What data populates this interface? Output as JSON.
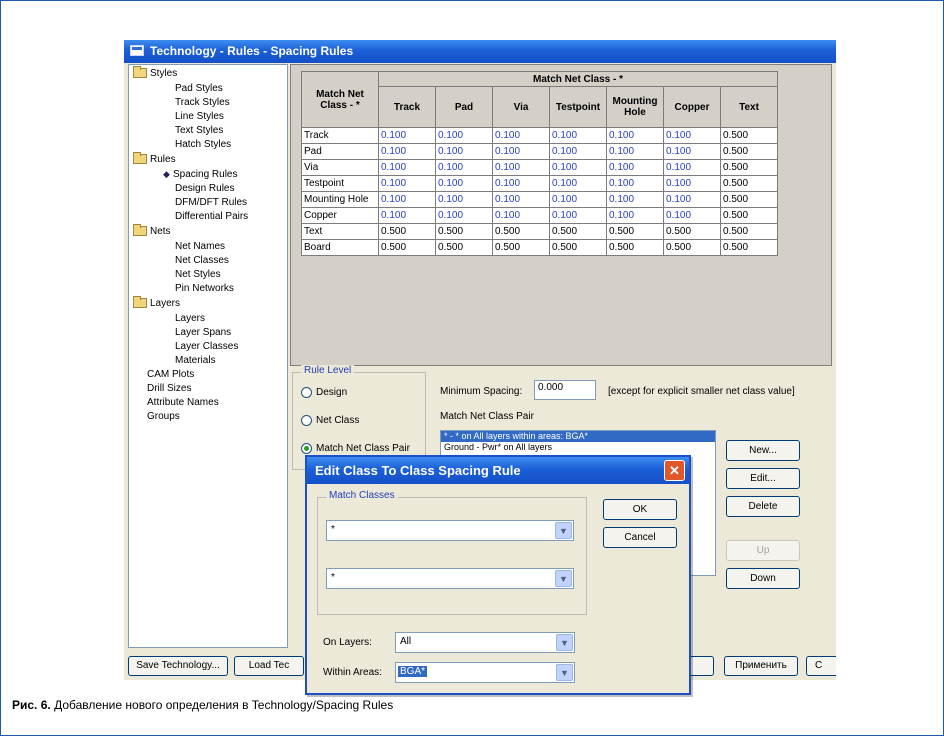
{
  "window_title": "Technology - Rules - Spacing Rules",
  "tree": {
    "styles": "Styles",
    "pad_styles": "Pad Styles",
    "track_styles": "Track Styles",
    "line_styles": "Line Styles",
    "text_styles": "Text Styles",
    "hatch_styles": "Hatch Styles",
    "rules": "Rules",
    "spacing_rules": "Spacing Rules",
    "design_rules": "Design Rules",
    "dfm_rules": "DFM/DFT Rules",
    "diff_pairs": "Differential Pairs",
    "nets": "Nets",
    "net_names": "Net Names",
    "net_classes": "Net Classes",
    "net_styles": "Net Styles",
    "pin_networks": "Pin Networks",
    "layers": "Layers",
    "layers_item": "Layers",
    "layer_spans": "Layer Spans",
    "layer_classes": "Layer Classes",
    "materials": "Materials",
    "cam_plots": "CAM Plots",
    "drill_sizes": "Drill Sizes",
    "attribute_names": "Attribute Names",
    "groups": "Groups"
  },
  "grid": {
    "title": "Match Net Class - *",
    "corner": "Match Net Class - *",
    "columns": [
      "Track",
      "Pad",
      "Via",
      "Testpoint",
      "Mounting Hole",
      "Copper",
      "Text"
    ],
    "rows": [
      {
        "label": "Track",
        "values": [
          "0.100",
          "0.100",
          "0.100",
          "0.100",
          "0.100",
          "0.100",
          "0.500"
        ]
      },
      {
        "label": "Pad",
        "values": [
          "0.100",
          "0.100",
          "0.100",
          "0.100",
          "0.100",
          "0.100",
          "0.500"
        ]
      },
      {
        "label": "Via",
        "values": [
          "0.100",
          "0.100",
          "0.100",
          "0.100",
          "0.100",
          "0.100",
          "0.500"
        ]
      },
      {
        "label": "Testpoint",
        "values": [
          "0.100",
          "0.100",
          "0.100",
          "0.100",
          "0.100",
          "0.100",
          "0.500"
        ]
      },
      {
        "label": "Mounting Hole",
        "values": [
          "0.100",
          "0.100",
          "0.100",
          "0.100",
          "0.100",
          "0.100",
          "0.500"
        ]
      },
      {
        "label": "Copper",
        "values": [
          "0.100",
          "0.100",
          "0.100",
          "0.100",
          "0.100",
          "0.100",
          "0.500"
        ]
      },
      {
        "label": "Text",
        "values": [
          "0.500",
          "0.500",
          "0.500",
          "0.500",
          "0.500",
          "0.500",
          "0.500"
        ]
      },
      {
        "label": "Board",
        "values": [
          "0.500",
          "0.500",
          "0.500",
          "0.500",
          "0.500",
          "0.500",
          "0.500"
        ]
      }
    ]
  },
  "rule_level": {
    "legend": "Rule Level",
    "design": "Design",
    "net_class": "Net Class",
    "match_pair": "Match Net Class Pair"
  },
  "min_spacing": {
    "label": "Minimum Spacing:",
    "value": "0.000",
    "note": "[except for explicit smaller net class value]"
  },
  "pair_list": {
    "label": "Match Net Class Pair",
    "items": [
      "* - * on All layers within areas: BGA*",
      "Ground - Pwr* on All layers"
    ]
  },
  "buttons": {
    "new": "New...",
    "edit": "Edit...",
    "delete": "Delete",
    "up": "Up",
    "down": "Down"
  },
  "bottom": {
    "save": "Save Technology...",
    "load": "Load Tec",
    "apply": "Применить",
    "cut": "C"
  },
  "dialog": {
    "title": "Edit Class To Class Spacing Rule",
    "close": "✕",
    "group": "Match Classes",
    "class1": "*",
    "class2": "*",
    "on_layers_label": "On Layers:",
    "on_layers": "All",
    "within_label": "Within Areas:",
    "within": "BGA*",
    "ok": "OK",
    "cancel": "Cancel"
  },
  "caption": {
    "prefix": "Рис. 6.",
    "text": " Добавление нового определения в Technology/Spacing Rules"
  },
  "colors": {
    "title_bar": "#1b5fd6",
    "values_blue": "#2a3fbf",
    "frame": "#1f5aa8"
  }
}
